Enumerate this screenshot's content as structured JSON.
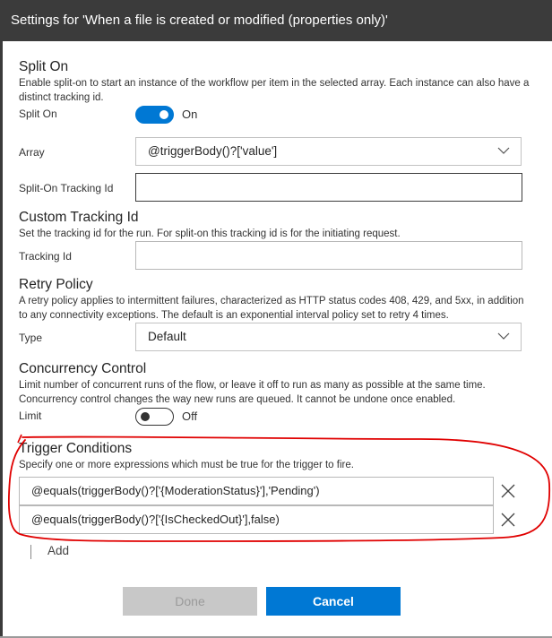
{
  "window": {
    "title": "Settings for 'When a file is created or modified (properties only)'"
  },
  "split_on": {
    "heading": "Split On",
    "description": "Enable split-on to start an instance of the workflow per item in the selected array. Each instance can also have a distinct tracking id.",
    "toggle_label": "Split On",
    "toggle_state": "On",
    "array_label": "Array",
    "array_value": "@triggerBody()?['value']",
    "tracking_label": "Split-On Tracking Id",
    "tracking_value": ""
  },
  "custom_tracking": {
    "heading": "Custom Tracking Id",
    "description": "Set the tracking id for the run. For split-on this tracking id is for the initiating request.",
    "label": "Tracking Id",
    "value": ""
  },
  "retry_policy": {
    "heading": "Retry Policy",
    "description": "A retry policy applies to intermittent failures, characterized as HTTP status codes 408, 429, and 5xx, in addition to any connectivity exceptions. The default is an exponential interval policy set to retry 4 times.",
    "type_label": "Type",
    "type_value": "Default"
  },
  "concurrency": {
    "heading": "Concurrency Control",
    "description": "Limit number of concurrent runs of the flow, or leave it off to run as many as possible at the same time. Concurrency control changes the way new runs are queued. It cannot be undone once enabled.",
    "limit_label": "Limit",
    "toggle_state": "Off"
  },
  "trigger_conditions": {
    "heading": "Trigger Conditions",
    "description": "Specify one or more expressions which must be true for the trigger to fire.",
    "conditions": [
      "@equals(triggerBody()?['{ModerationStatus}'],'Pending')",
      "@equals(triggerBody()?['{IsCheckedOut}'],false)"
    ],
    "add_label": "Add"
  },
  "footer": {
    "done_label": "Done",
    "cancel_label": "Cancel"
  },
  "colors": {
    "title_bar": "#3b3b3b",
    "accent": "#0078d4",
    "annotation": "#e00000",
    "disabled_button": "#c8c8c8"
  },
  "icons": [
    "chevron-down-icon",
    "close-icon",
    "plus-icon"
  ]
}
